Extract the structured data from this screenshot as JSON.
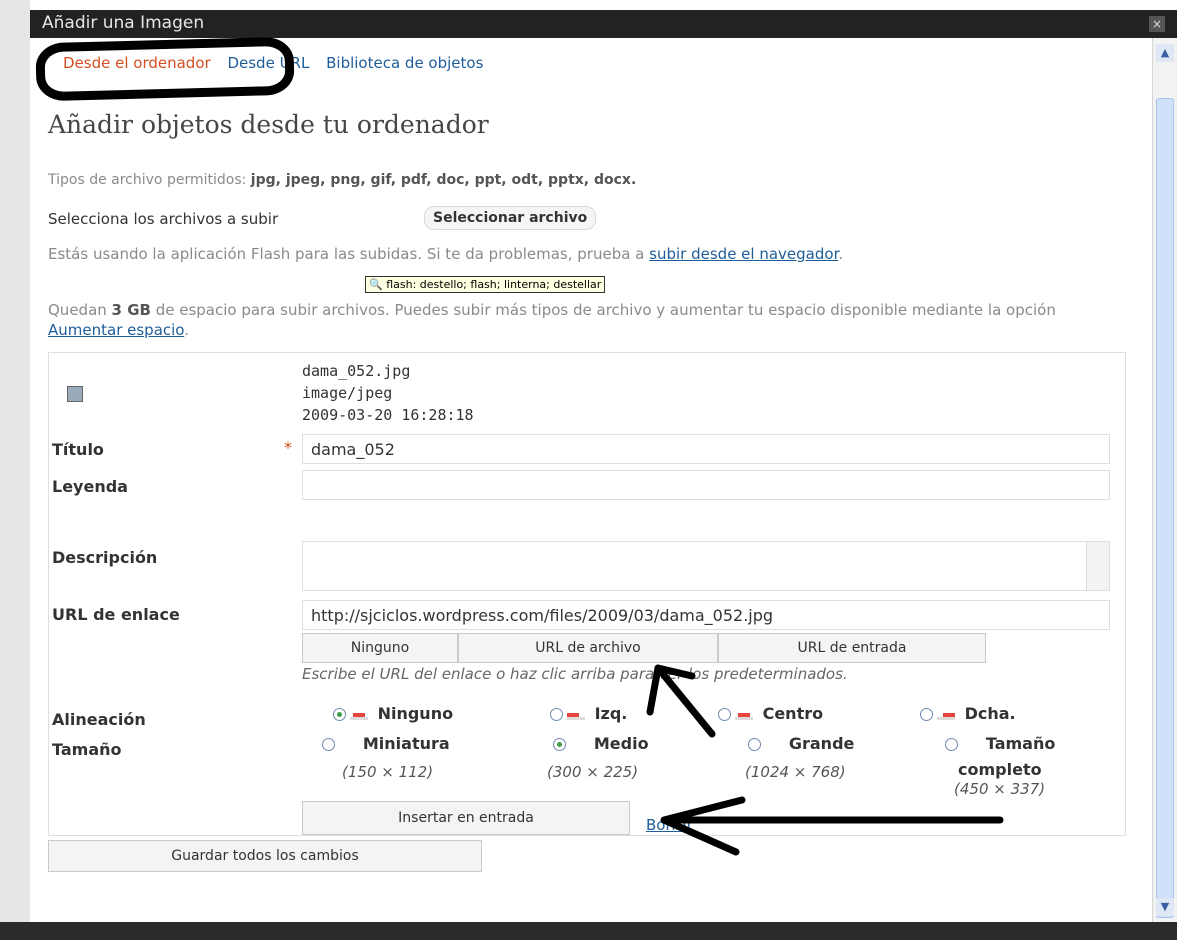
{
  "window": {
    "title": "Añadir una Imagen",
    "close": "×"
  },
  "tabs": [
    {
      "label": "Desde el ordenador",
      "active": true
    },
    {
      "label": "Desde URL",
      "active": false
    },
    {
      "label": "Biblioteca de objetos",
      "active": false
    }
  ],
  "heading": "Añadir objetos desde tu ordenador",
  "file_types": {
    "label": "Tipos de archivo permitidos:",
    "value": "jpg, jpeg, png, gif, pdf, doc, ppt, odt, pptx, docx."
  },
  "select": {
    "label": "Selecciona los archivos a subir",
    "button": "Seleccionar archivo"
  },
  "flash_note": {
    "text": "Estás usando la aplicación Flash para las subidas. Si te da problemas, prueba a ",
    "link": "subir desde el navegador",
    "end": "."
  },
  "tooltip": "flash: destello; flash; linterna; destellar",
  "quota": {
    "pre": "Quedan ",
    "amount": "3 GB",
    "post": " de espacio para subir archivos. Puedes subir más tipos de archivo y aumentar tu espacio disponible mediante la opción ",
    "link": "Aumentar espacio",
    "end": "."
  },
  "media": {
    "filename": "dama_052.jpg",
    "mime": "image/jpeg",
    "date": "2009-03-20 16:28:18",
    "title_label": "Título",
    "required_mark": "*",
    "title_value": "dama_052",
    "caption_label": "Leyenda",
    "caption_value": "",
    "description_label": "Descripción",
    "link_label": "URL de enlace",
    "link_value": "http://sjciclos.wordpress.com/files/2009/03/dama_052.jpg",
    "link_buttons": [
      "Ninguno",
      "URL de archivo",
      "URL de entrada"
    ],
    "link_hint": "Escribe el URL del enlace o haz clic arriba para ver los predeterminados.",
    "align_label": "Alineación",
    "align_options": [
      {
        "label": "Ninguno",
        "selected": true
      },
      {
        "label": "Izq.",
        "selected": false
      },
      {
        "label": "Centro",
        "selected": false
      },
      {
        "label": "Dcha.",
        "selected": false
      }
    ],
    "size_label": "Tamaño",
    "size_options": [
      {
        "label": "Miniatura",
        "dims": "(150 × 112)",
        "selected": false
      },
      {
        "label": "Medio",
        "dims": "(300 × 225)",
        "selected": true
      },
      {
        "label": "Grande",
        "dims": "(1024 × 768)",
        "selected": false
      },
      {
        "label": "Tamaño",
        "label2": "completo",
        "dims": "(450 × 337)",
        "selected": false
      }
    ],
    "insert_button": "Insertar en entrada",
    "delete_link": "Borrar"
  },
  "save_button": "Guardar todos los cambios",
  "colors": {
    "active_tab": "#d54e21",
    "link": "#1f5d9a",
    "required": "#d54e21"
  }
}
